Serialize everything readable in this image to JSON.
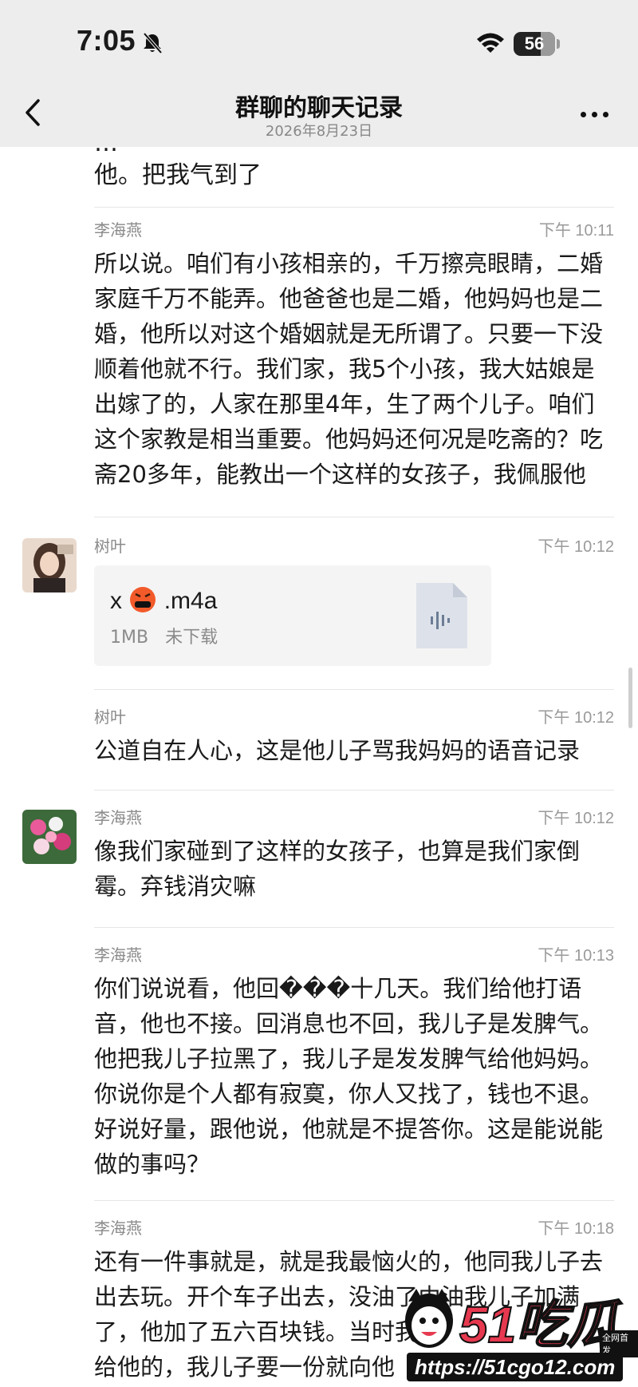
{
  "status_bar": {
    "time": "7:05",
    "battery": "56"
  },
  "header": {
    "title": "群聊的聊天记录",
    "date": "2026年8月23日"
  },
  "partial_message": {
    "cut_line": "…",
    "last_line": "他。把我气到了"
  },
  "messages": [
    {
      "sender": "李海燕",
      "time": "下午 10:11",
      "text": "所以说。咱们有小孩相亲的，千万擦亮眼睛，二婚\n家庭千万不能弄。他爸爸也是二婚，他妈妈也是二\n婚，他所以对这个婚姻就是无所谓了。只要一下没\n顺着他就不行。我们家，我5个小孩，我大姑娘是\n出嫁了的，人家在那里4年，生了两个儿子。咱们\n这个家教是相当重要。他妈妈还何况是吃斋的？吃\n斋20多年，能教出一个这样的女孩子，我佩服他"
    },
    {
      "sender": "树叶",
      "time": "下午 10:12",
      "file": {
        "name_prefix": "x",
        "name_suffix": ".m4a",
        "size": "1MB",
        "status": "未下载"
      }
    },
    {
      "sender": "树叶",
      "time": "下午 10:12",
      "text": "公道自在人心，这是他儿子骂我妈妈的语音记录"
    },
    {
      "sender": "李海燕",
      "time": "下午 10:12",
      "text": "像我们家碰到了这样的女孩子，也算是我们家倒\n霉。弃钱消灾嘛"
    },
    {
      "sender": "李海燕",
      "time": "下午 10:13",
      "text": "你们说说看，他回���十几天。我们给他打语\n音，他也不接。回消息也不回，我儿子是发脾气。\n他把我儿子拉黑了，我儿子是发发脾气给他妈妈。\n你说你是个人都有寂寞，你人又找了，钱也不退。\n好说好量，跟他说，他就是不提答你。这是能说能\n做的事吗？"
    },
    {
      "sender": "李海燕",
      "time": "下午 10:18",
      "text": "还有一件事就是，就是我最恼火的，他同我儿子去\n出去玩。开个车子出去，没油了由油我儿子加满\n了，他加了五六百块钱。当时我                     打\n给他的，我儿子要一份就向他"
    }
  ],
  "watermark": {
    "logo": "51吃瓜",
    "url": "https://51cgo12.com",
    "tag": "全网首发"
  },
  "colors": {
    "bar_bg": "#ededed",
    "page_bg": "#ffffff",
    "meta_text": "#8a8a8a",
    "watermark_red": "#e6394f"
  }
}
